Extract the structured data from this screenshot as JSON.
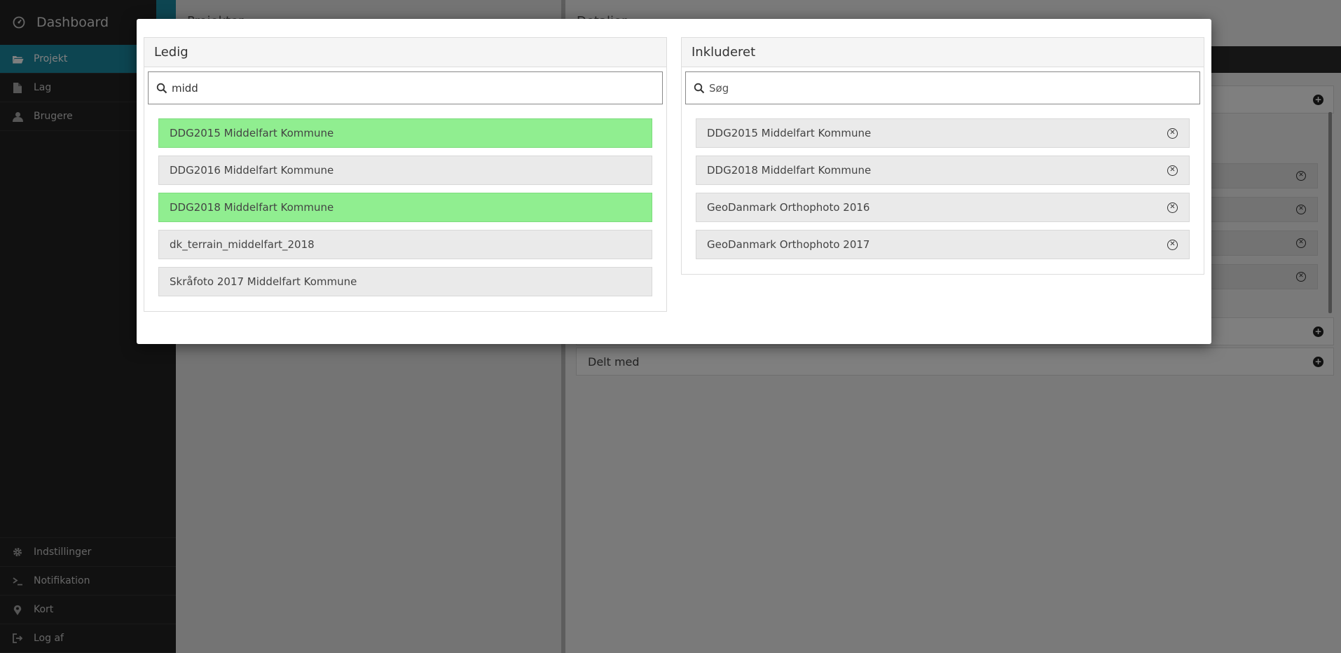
{
  "sidebar": {
    "brand": "Dashboard",
    "items": [
      {
        "label": "Projekt",
        "icon": "folder-icon",
        "active": true
      },
      {
        "label": "Lag",
        "icon": "file-icon",
        "active": false
      },
      {
        "label": "Brugere",
        "icon": "user-icon",
        "active": false
      }
    ],
    "bottom_items": [
      {
        "label": "Indstillinger",
        "icon": "gear-icon"
      },
      {
        "label": "Notifikation",
        "icon": "terminal-icon"
      },
      {
        "label": "Kort",
        "icon": "map-marker-icon"
      },
      {
        "label": "Log af",
        "icon": "sign-out-icon"
      }
    ]
  },
  "background": {
    "left_title": "Projekter",
    "right_title": "Detaljer",
    "delt_med": "Delt med"
  },
  "modal": {
    "available": {
      "title": "Ledig",
      "search_value": "midd",
      "items": [
        {
          "label": "DDG2015 Middelfart Kommune",
          "selected": true
        },
        {
          "label": "DDG2016 Middelfart Kommune",
          "selected": false
        },
        {
          "label": "DDG2018 Middelfart Kommune",
          "selected": true
        },
        {
          "label": "dk_terrain_middelfart_2018",
          "selected": false
        },
        {
          "label": "Skråfoto 2017 Middelfart Kommune",
          "selected": false
        }
      ]
    },
    "included": {
      "title": "Inkluderet",
      "search_placeholder": "Søg",
      "items": [
        {
          "label": "DDG2015 Middelfart Kommune"
        },
        {
          "label": "DDG2018 Middelfart Kommune"
        },
        {
          "label": "GeoDanmark Orthophoto 2016"
        },
        {
          "label": "GeoDanmark Orthophoto 2017"
        }
      ]
    }
  },
  "colors": {
    "accent": "#1a8aa3",
    "selected_item": "#90ee90"
  }
}
